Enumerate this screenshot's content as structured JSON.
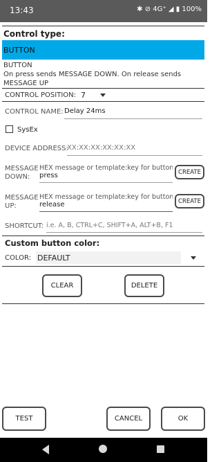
{
  "status": {
    "time": "13:43",
    "indicators": "✱ ⊘ 4G⁺ ◢ ▮ 100%"
  },
  "header": {
    "control_type_label": "Control type:",
    "selected_type": "BUTTON",
    "type_name": "BUTTON",
    "type_description": "On press sends MESSAGE DOWN. On release sends MESSAGE UP"
  },
  "fields": {
    "position_label": "CONTROL POSITION:",
    "position_value": "7",
    "name_label": "CONTROL NAME:",
    "name_value": "Delay 24ms",
    "sysex_label": "SysEx",
    "device_address_label": "DEVICE ADDRESS:",
    "device_address_placeholder": "XX:XX:XX:XX:XX:XX",
    "message_down_label_1": "MESSAGE",
    "message_down_label_2": "DOWN:",
    "message_down_hint": "HEX message or template:key for button",
    "message_down_value": "press",
    "message_up_label_1": "MESSAGE",
    "message_up_label_2": "UP:",
    "message_up_hint": "HEX message or template:key for button",
    "message_up_value": "release",
    "create_label": "CREATE",
    "shortcut_label": "SHORTCUT:",
    "shortcut_placeholder": "i.e. A, B, CTRL+C, SHIFT+A, ALT+B, F1"
  },
  "color": {
    "section_label": "Custom button color:",
    "color_label": "COLOR:",
    "color_value": "DEFAULT"
  },
  "actions": {
    "clear": "CLEAR",
    "delete": "DELETE",
    "test": "TEST",
    "cancel": "CANCEL",
    "ok": "OK"
  }
}
